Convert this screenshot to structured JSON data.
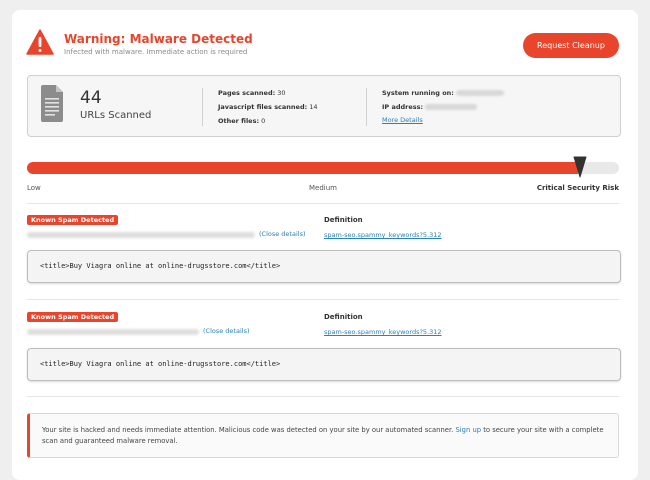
{
  "colors": {
    "accent": "#e8452c",
    "link": "#2a7fbf"
  },
  "header": {
    "title": "Warning: Malware Detected",
    "subtitle": "Infected with malware. Immediate action is required",
    "cleanup_button": "Request Cleanup",
    "icon": "warning-icon"
  },
  "stats": {
    "icon": "document-icon",
    "urls_count": "44",
    "urls_label": "URLs Scanned",
    "pages_label": "Pages scanned:",
    "pages_value": "30",
    "js_label": "Javascript files scanned:",
    "js_value": "14",
    "other_label": "Other files:",
    "other_value": "0",
    "system_label": "System running on:",
    "ip_label": "IP address:",
    "more_details": "More Details"
  },
  "risk": {
    "level_percent": 93,
    "low": "Low",
    "medium": "Medium",
    "critical": "Critical Security Risk"
  },
  "spam": [
    {
      "badge": "Known Spam Detected",
      "close_label": "(Close details)",
      "definition_title": "Definition",
      "definition_link": "spam-seo.spammy_keywords?5.312",
      "code": "<title>Buy Viagra online at online-drugsstore.com</title>"
    },
    {
      "badge": "Known Spam Detected",
      "close_label": "(Close details)",
      "definition_title": "Definition",
      "definition_link": "spam-seo.spammy_keywords?5.312",
      "code": "<title>Buy Viagra online at online-drugsstore.com</title>"
    }
  ],
  "notice": {
    "text_before": "Your site is hacked and needs immediate attention. Malicious code was detected on your site by our automated scanner. ",
    "link": "Sign up",
    "text_after": " to secure your site with a complete scan and guaranteed malware removal."
  }
}
